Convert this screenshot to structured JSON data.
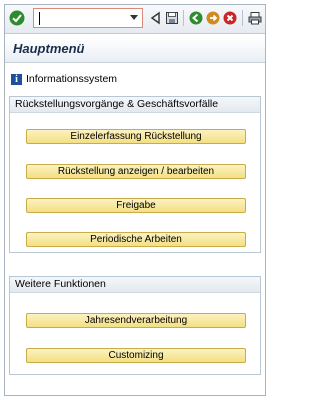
{
  "toolbar": {
    "command_field": {
      "value": "",
      "placeholder": ""
    },
    "icons": [
      "ok-icon",
      "back-icon",
      "save-icon",
      "previous-icon",
      "next-icon",
      "cancel-icon",
      "print-icon"
    ]
  },
  "header": {
    "title": "Hauptmenü"
  },
  "info_link": {
    "label": "Informationssystem"
  },
  "groups": [
    {
      "title": "Rückstellungsvorgänge & Geschäftsvorfälle",
      "buttons": [
        {
          "label": "Einzelerfassung Rückstellung"
        },
        {
          "label": "Rückstellung anzeigen / bearbeiten"
        },
        {
          "label": "Freigabe"
        },
        {
          "label": "Periodische Arbeiten"
        }
      ]
    },
    {
      "title": "Weitere Funktionen",
      "buttons": [
        {
          "label": "Jahresendverarbeitung"
        },
        {
          "label": "Customizing"
        }
      ]
    }
  ],
  "colors": {
    "button_fill": "#f3df83",
    "button_border": "#c8ac4a",
    "ok_green": "#2e8b2e",
    "info_blue": "#1f4f9a",
    "command_border": "#d98b7a"
  }
}
